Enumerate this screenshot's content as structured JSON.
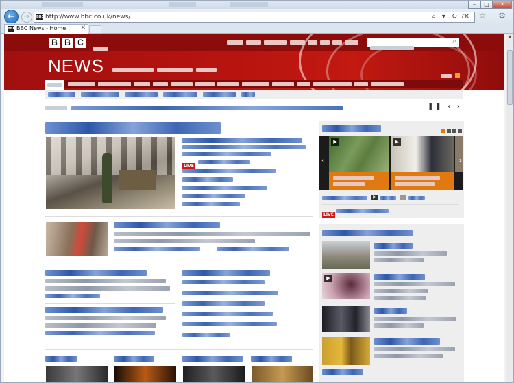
{
  "browser": {
    "url": "http://www.bbc.co.uk/news/",
    "tab_title": "BBC News - Home",
    "favicon_text": "BBC",
    "window_controls": [
      "–",
      "□",
      "✕"
    ],
    "address_icons": "⌕ ▾ ↻ ✕",
    "toolbar_icons": "⌂ ☆ ⚙",
    "back_icon": "←",
    "forward_icon": "→",
    "close_tab_icon": "✕"
  },
  "masthead": {
    "logo_letters": [
      "B",
      "B",
      "C"
    ],
    "section_title": "NEWS",
    "search_icon": "⌕"
  },
  "ticker": {
    "controls": "❚❚ ‹ ›"
  },
  "top_story": {
    "live_badge": "LIVE"
  },
  "sidebar": {
    "live_badge": "LIVE",
    "play_icon": "▶",
    "prev_icon": "‹",
    "next_icon": "›"
  },
  "colors": {
    "bbc_red": "#b7140f",
    "link_blue": "#3c63b0",
    "video_orange": "#e07a10"
  }
}
